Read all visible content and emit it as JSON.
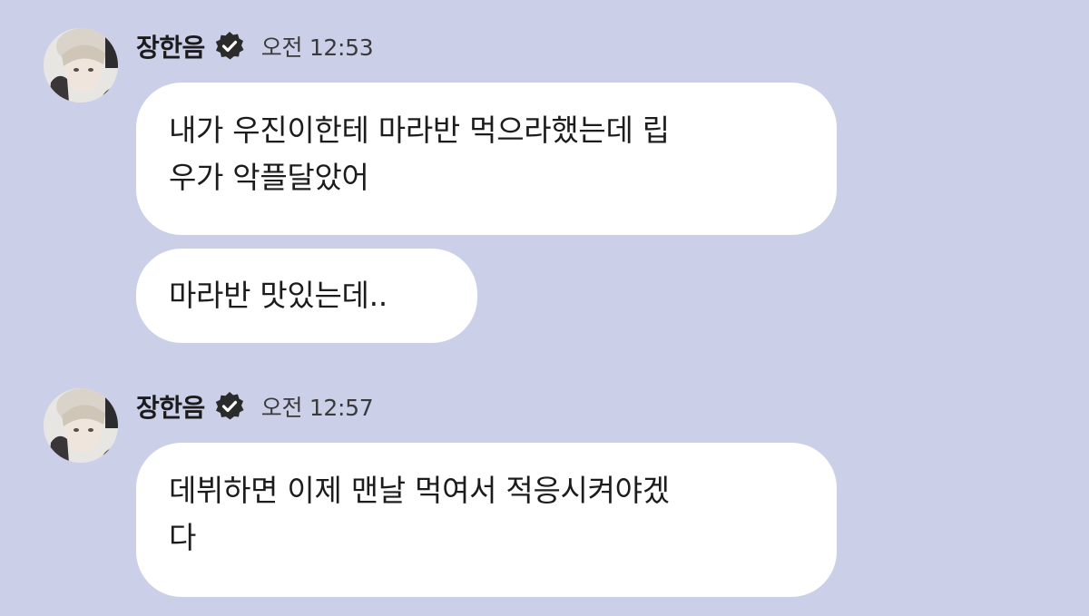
{
  "messages": [
    {
      "sender": "장한음",
      "time": "오전 12:53",
      "bubbles": [
        {
          "line1": "내가 우진이한테 마라반 먹으라했는데 립",
          "line2": "우가 악플달았어"
        },
        {
          "line1": "마라반 맛있는데.."
        }
      ]
    },
    {
      "sender": "장한음",
      "time": "오전 12:57",
      "bubbles": [
        {
          "line1": "데뷔하면 이제 맨날 먹여서 적응시켜야겠",
          "line2": "다"
        }
      ]
    }
  ],
  "icons": {
    "avatar": "avatar-photo",
    "verified": "verified-badge-icon"
  },
  "colors": {
    "background": "#cbcfe8",
    "bubble": "#ffffff",
    "text": "#1b1b1b",
    "verified_badge": "#2b2b2b"
  }
}
